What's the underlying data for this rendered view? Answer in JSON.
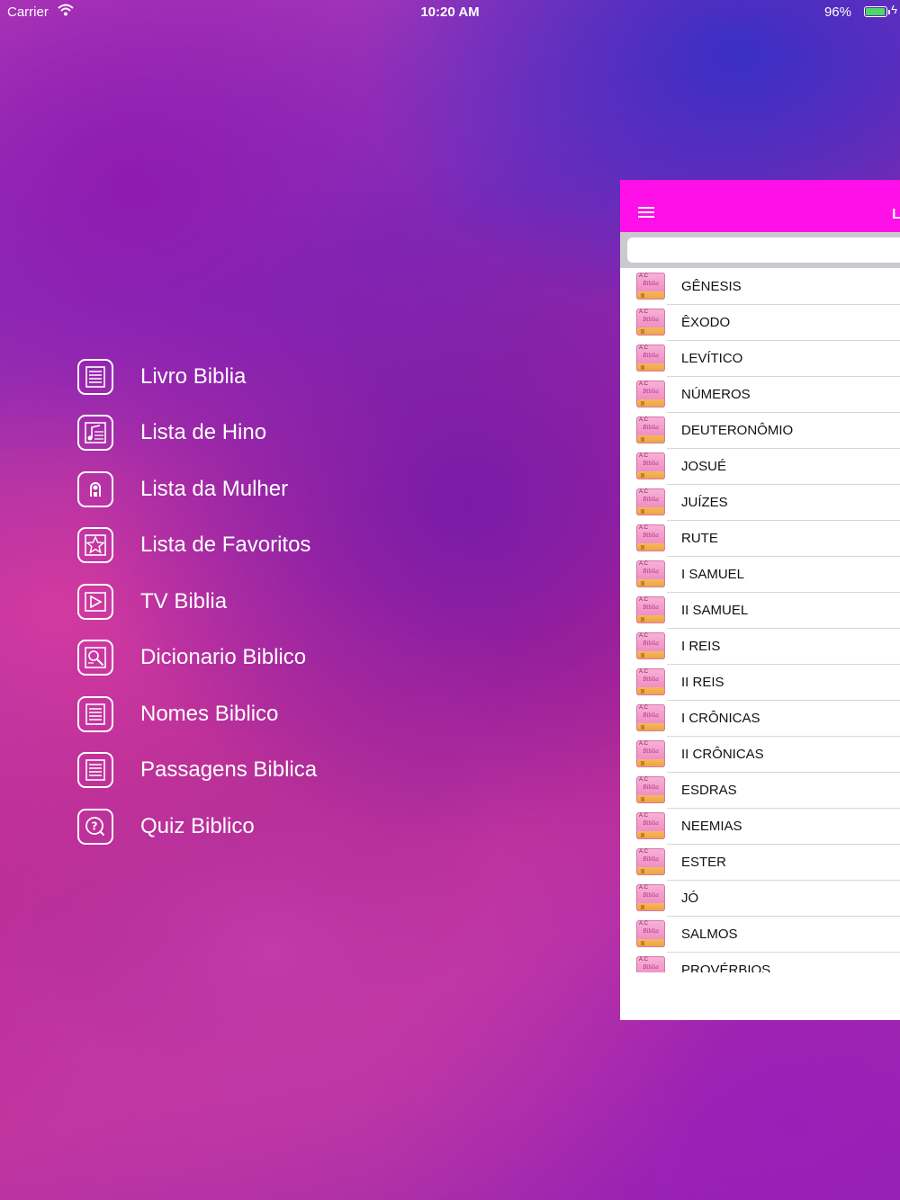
{
  "status_bar": {
    "carrier": "Carrier",
    "time": "10:20 AM",
    "battery": "96%",
    "battery_level": 0.96
  },
  "menu": {
    "items": [
      {
        "label": "Livro Biblia",
        "icon": "book-lines-icon"
      },
      {
        "label": "Lista de Hino",
        "icon": "music-note-icon"
      },
      {
        "label": "Lista da Mulher",
        "icon": "woman-icon"
      },
      {
        "label": "Lista de Favoritos",
        "icon": "star-icon"
      },
      {
        "label": "TV Biblia",
        "icon": "play-icon"
      },
      {
        "label": "Dicionario Biblico",
        "icon": "magnifier-icon"
      },
      {
        "label": "Nomes Biblico",
        "icon": "list-icon"
      },
      {
        "label": "Passagens Biblica",
        "icon": "list-icon"
      },
      {
        "label": "Quiz Biblico",
        "icon": "question-icon"
      }
    ]
  },
  "panel": {
    "header_title": "L",
    "header_color": "#ff10e8",
    "search_placeholder": "",
    "book_icon_text": "Biblia",
    "books": [
      "GÊNESIS",
      "ÊXODO",
      "LEVÍTICO",
      "NÚMEROS",
      "DEUTERONÔMIO",
      "JOSUÉ",
      "JUÍZES",
      "RUTE",
      "I SAMUEL",
      "II SAMUEL",
      "I REIS",
      "II REIS",
      "I CRÔNICAS",
      "II CRÔNICAS",
      "ESDRAS",
      "NEEMIAS",
      "ESTER",
      "JÓ",
      "SALMOS",
      "PROVÉRBIOS"
    ]
  }
}
